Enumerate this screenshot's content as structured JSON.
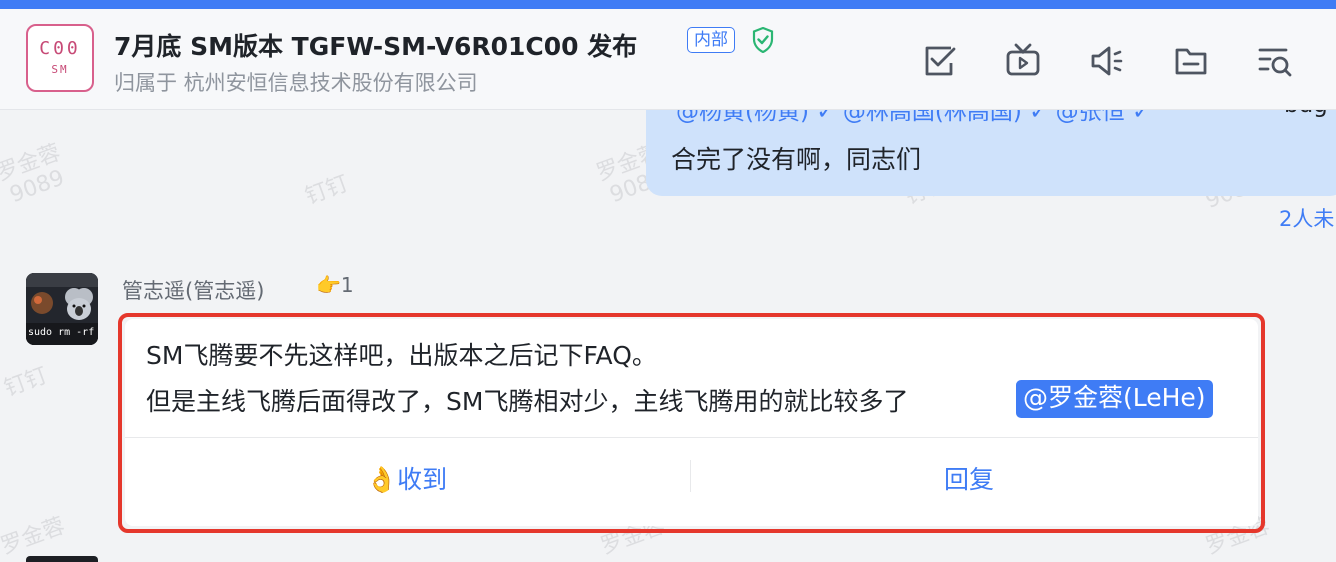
{
  "header": {
    "logo_line1": "C00",
    "logo_line2": "SM",
    "title": "7月底 SM版本 TGFW-SM-V6R01C00 发布",
    "tag": "内部",
    "subtitle": "归属于 杭州安恒信息技术股份有限公司",
    "icons": [
      "task-check-icon",
      "live-tv-icon",
      "announcement-icon",
      "folder-icon",
      "search-list-icon"
    ]
  },
  "previous_message": {
    "mentions_line": "@杨黄(杨黄)  ✓  @林高国(林高国)  ✓  @张恒  ✓",
    "trailing_text": "bug",
    "text": "合完了没有啊，同志们",
    "read_status": "2人未"
  },
  "watermark": {
    "name": "罗金蓉",
    "id": "9089",
    "brand": "钉钉"
  },
  "message": {
    "avatar_text": "sudo rm -rf /*",
    "sender": "管志遥(管志遥)",
    "reaction_count": "1",
    "line1": "SM飞腾要不先这样吧，出版本之后记下FAQ。",
    "line2": "但是主线飞腾后面得改了，SM飞腾相对少，主线飞腾用的就比较多了",
    "mention": "@罗金蓉(LeHe)",
    "ack_label": "收到",
    "reply_label": "回复"
  },
  "colors": {
    "accent": "#3f7cf5",
    "highlight_border": "#e5372c",
    "bubble_bg": "#cfe2fb",
    "shield": "#2bb673",
    "logo": "#d8608c"
  }
}
